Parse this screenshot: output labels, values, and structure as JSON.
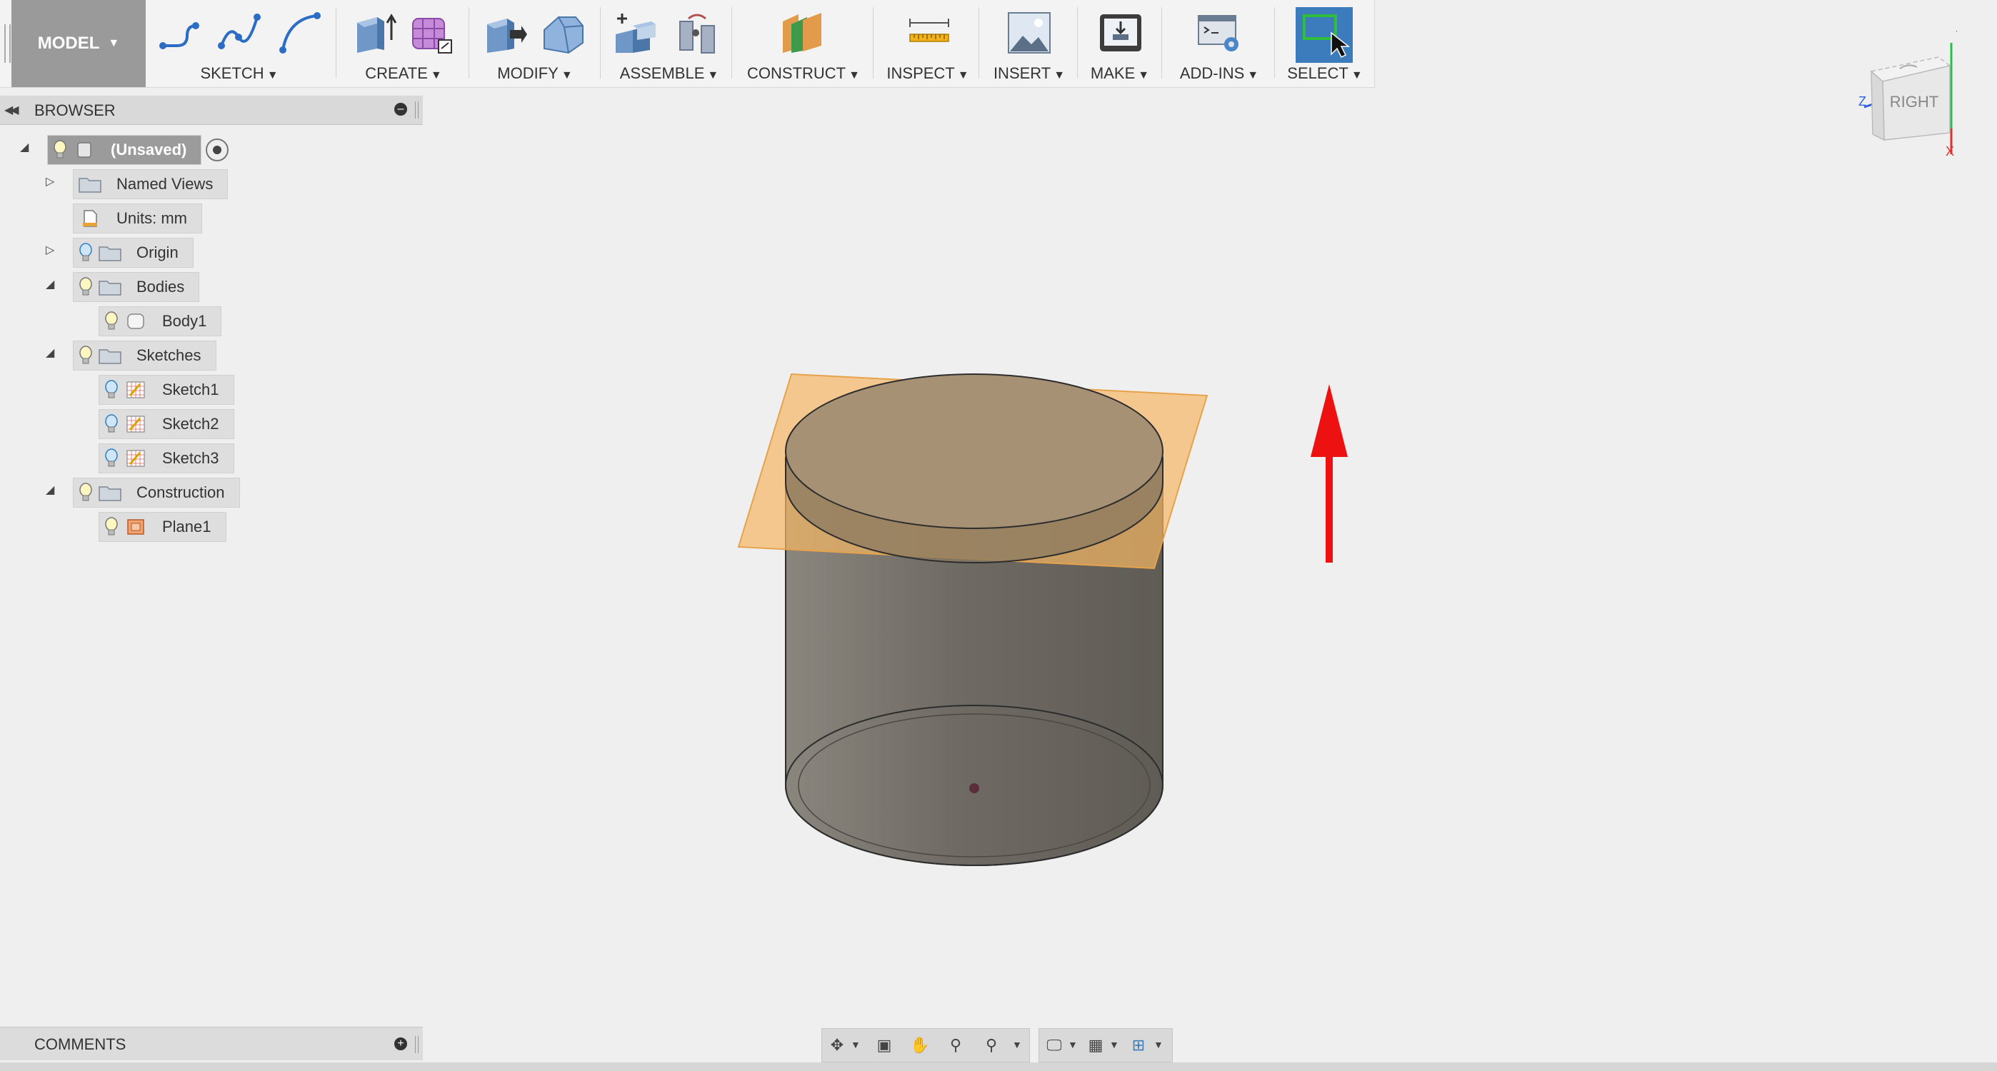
{
  "toolbar": {
    "model_label": "MODEL",
    "groups": {
      "sketch": "SKETCH",
      "create": "CREATE",
      "modify": "MODIFY",
      "assemble": "ASSEMBLE",
      "construct": "CONSTRUCT",
      "inspect": "INSPECT",
      "insert": "INSERT",
      "make": "MAKE",
      "addins": "ADD-INS",
      "select": "SELECT"
    }
  },
  "browser": {
    "title": "BROWSER",
    "root": "(Unsaved)",
    "items": {
      "named_views": "Named Views",
      "units": "Units: mm",
      "origin": "Origin",
      "bodies": "Bodies",
      "body1": "Body1",
      "sketches": "Sketches",
      "sketch1": "Sketch1",
      "sketch2": "Sketch2",
      "sketch3": "Sketch3",
      "construction": "Construction",
      "plane1": "Plane1"
    }
  },
  "comments": {
    "title": "COMMENTS"
  },
  "viewcube": {
    "face": "RIGHT",
    "axis_y": "Y",
    "axis_x": "X",
    "axis_z": "Z"
  },
  "colors": {
    "plane": "#f5b764",
    "body": "#7a756d",
    "arrow": "#ee1111",
    "select_active": "#3d7cbc"
  }
}
